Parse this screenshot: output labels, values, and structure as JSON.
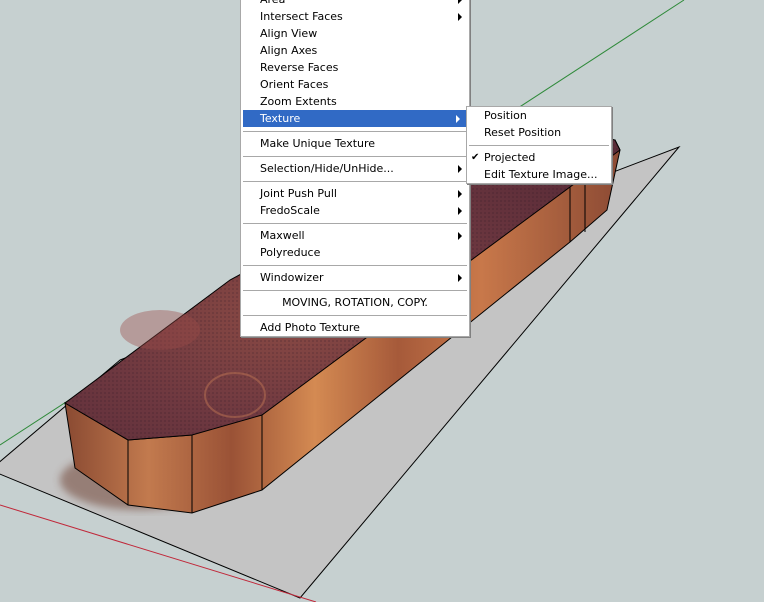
{
  "scene": {
    "background_color": "#c6d0d0",
    "ground_color": "#c4c4c4",
    "axes": {
      "green": "#2f8a3a",
      "red": "#c0283a"
    },
    "model": {
      "description": "textured wooden slab",
      "top_color": "#6e3a3a",
      "side_color": "#b06a40"
    }
  },
  "context_menu": {
    "items": [
      {
        "type": "item",
        "label": "Area",
        "submenu": true
      },
      {
        "type": "item",
        "label": "Intersect Faces",
        "submenu": true
      },
      {
        "type": "item",
        "label": "Align View",
        "submenu": false
      },
      {
        "type": "item",
        "label": "Align Axes",
        "submenu": false
      },
      {
        "type": "item",
        "label": "Reverse Faces",
        "submenu": false
      },
      {
        "type": "item",
        "label": "Orient Faces",
        "submenu": false
      },
      {
        "type": "item",
        "label": "Zoom Extents",
        "submenu": false
      },
      {
        "type": "item",
        "label": "Texture",
        "submenu": true,
        "highlighted": true
      },
      {
        "type": "separator"
      },
      {
        "type": "item",
        "label": "Make Unique Texture",
        "submenu": false
      },
      {
        "type": "separator"
      },
      {
        "type": "item",
        "label": "Selection/Hide/UnHide...",
        "submenu": true
      },
      {
        "type": "separator"
      },
      {
        "type": "item",
        "label": "Joint Push Pull",
        "submenu": true
      },
      {
        "type": "item",
        "label": "FredoScale",
        "submenu": true
      },
      {
        "type": "separator"
      },
      {
        "type": "item",
        "label": "Maxwell",
        "submenu": true
      },
      {
        "type": "item",
        "label": "Polyreduce",
        "submenu": false
      },
      {
        "type": "separator"
      },
      {
        "type": "item",
        "label": "Windowizer",
        "submenu": true
      },
      {
        "type": "separator"
      },
      {
        "type": "item",
        "label": "MOVING, ROTATION, COPY.",
        "submenu": false,
        "centered": true
      },
      {
        "type": "separator"
      },
      {
        "type": "item",
        "label": "Add Photo Texture",
        "submenu": false
      }
    ],
    "highlight_color": "#316ac5"
  },
  "texture_submenu": {
    "items": [
      {
        "type": "item",
        "label": "Position"
      },
      {
        "type": "item",
        "label": "Reset Position"
      },
      {
        "type": "separator"
      },
      {
        "type": "item",
        "label": "Projected",
        "checked": true
      },
      {
        "type": "item",
        "label": "Edit Texture Image..."
      }
    ]
  }
}
